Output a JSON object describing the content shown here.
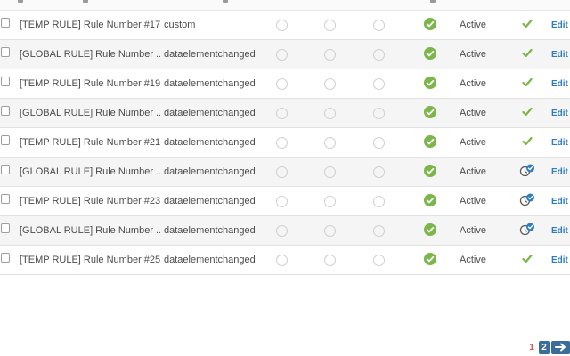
{
  "rows": [
    {
      "name": "[TEMP RULE] Rule Number #17",
      "event": "custom",
      "status": "Active",
      "published": "check",
      "edit": "Edit"
    },
    {
      "name": "[GLOBAL RULE] Rule Number ...",
      "event": "dataelementchanged",
      "status": "Active",
      "published": "check",
      "edit": "Edit"
    },
    {
      "name": "[TEMP RULE] Rule Number #19",
      "event": "dataelementchanged",
      "status": "Active",
      "published": "check",
      "edit": "Edit"
    },
    {
      "name": "[GLOBAL RULE] Rule Number ...",
      "event": "dataelementchanged",
      "status": "Active",
      "published": "check",
      "edit": "Edit"
    },
    {
      "name": "[TEMP RULE] Rule Number #21",
      "event": "dataelementchanged",
      "status": "Active",
      "published": "check",
      "edit": "Edit"
    },
    {
      "name": "[GLOBAL RULE] Rule Number ...",
      "event": "dataelementchanged",
      "status": "Active",
      "published": "pending",
      "edit": "Edit"
    },
    {
      "name": "[TEMP RULE] Rule Number #23",
      "event": "dataelementchanged",
      "status": "Active",
      "published": "pending",
      "edit": "Edit"
    },
    {
      "name": "[GLOBAL RULE] Rule Number ...",
      "event": "dataelementchanged",
      "status": "Active",
      "published": "pending",
      "edit": "Edit"
    },
    {
      "name": "[TEMP RULE] Rule Number #25",
      "event": "dataelementchanged",
      "status": "Active",
      "published": "check",
      "edit": "Edit"
    }
  ],
  "pagination": {
    "page_1": "1",
    "page_2": "2",
    "current": "2"
  },
  "colors": {
    "accent_green": "#7ab648",
    "link_blue": "#2d7dc4",
    "page_red": "#d9534f",
    "pager_blue": "#3a6d99"
  }
}
